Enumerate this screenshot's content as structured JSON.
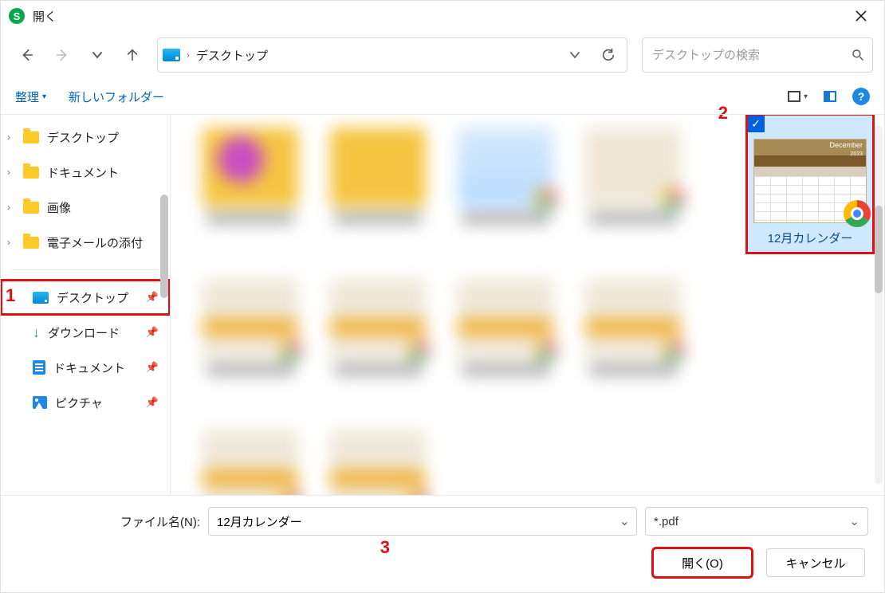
{
  "title": "開く",
  "nav": {
    "crumb": "デスクトップ"
  },
  "search": {
    "placeholder": "デスクトップの検索"
  },
  "toolbar": {
    "organize": "整理",
    "new_folder": "新しいフォルダー"
  },
  "sidebar": {
    "tree": [
      {
        "label": "デスクトップ"
      },
      {
        "label": "ドキュメント"
      },
      {
        "label": "画像"
      },
      {
        "label": "電子メールの添付"
      }
    ],
    "quick": [
      {
        "label": "デスクトップ"
      },
      {
        "label": "ダウンロード"
      },
      {
        "label": "ドキュメント"
      },
      {
        "label": "ピクチャ"
      }
    ]
  },
  "selected_file": {
    "name": "12月カレンダー",
    "month_label": "December",
    "year_label": "2023"
  },
  "filename_label": "ファイル名(N):",
  "filename_value": "12月カレンダー",
  "filter_value": "*.pdf",
  "buttons": {
    "open": "開く(O)",
    "cancel": "キャンセル"
  },
  "annotations": {
    "a1": "1",
    "a2": "2",
    "a3": "3"
  }
}
